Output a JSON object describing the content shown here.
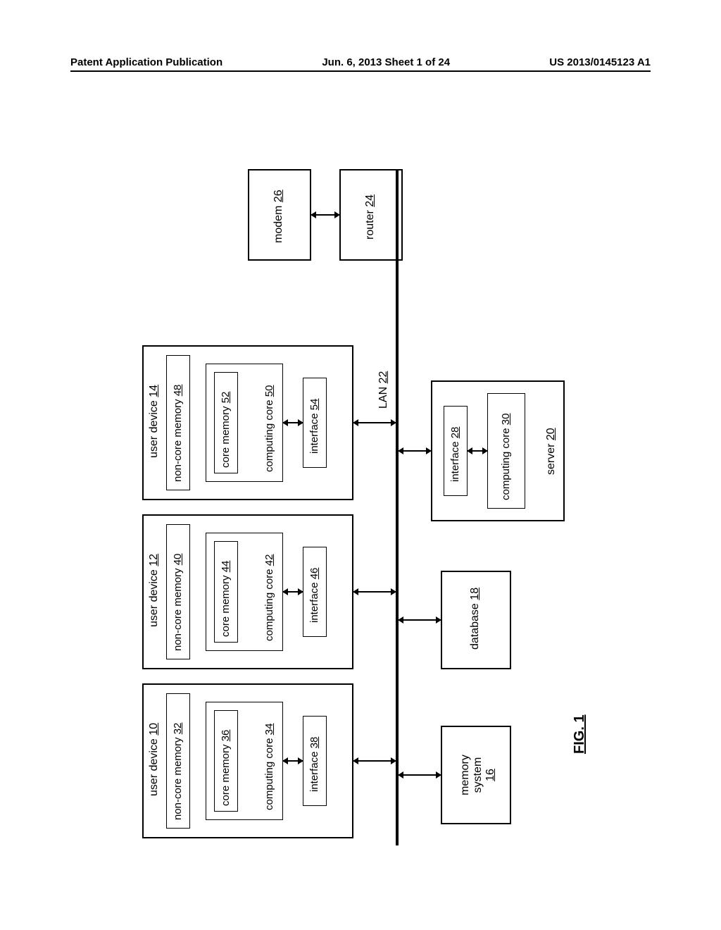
{
  "header": {
    "left": "Patent Application Publication",
    "center": "Jun. 6, 2013  Sheet 1 of 24",
    "right": "US 2013/0145123 A1"
  },
  "lan": {
    "label": "LAN",
    "num": "22"
  },
  "modem": {
    "label": "modem",
    "num": "26"
  },
  "router": {
    "label": "router",
    "num": "24"
  },
  "devices": [
    {
      "title": "user device",
      "title_num": "10",
      "noncore": "non-core memory",
      "noncore_num": "32",
      "coremem": "core memory",
      "coremem_num": "36",
      "core": "computing core",
      "core_num": "34",
      "iface": "interface",
      "iface_num": "38"
    },
    {
      "title": "user device",
      "title_num": "12",
      "noncore": "non-core memory",
      "noncore_num": "40",
      "coremem": "core memory",
      "coremem_num": "44",
      "core": "computing core",
      "core_num": "42",
      "iface": "interface",
      "iface_num": "46"
    },
    {
      "title": "user device",
      "title_num": "14",
      "noncore": "non-core memory",
      "noncore_num": "48",
      "coremem": "core memory",
      "coremem_num": "52",
      "core": "computing core",
      "core_num": "50",
      "iface": "interface",
      "iface_num": "54"
    }
  ],
  "memsys": {
    "label": "memory system",
    "num": "16"
  },
  "database": {
    "label": "database",
    "num": "18"
  },
  "server": {
    "title": "server",
    "title_num": "20",
    "iface": "interface",
    "iface_num": "28",
    "core": "computing core",
    "core_num": "30"
  },
  "figure": "FIG. 1"
}
